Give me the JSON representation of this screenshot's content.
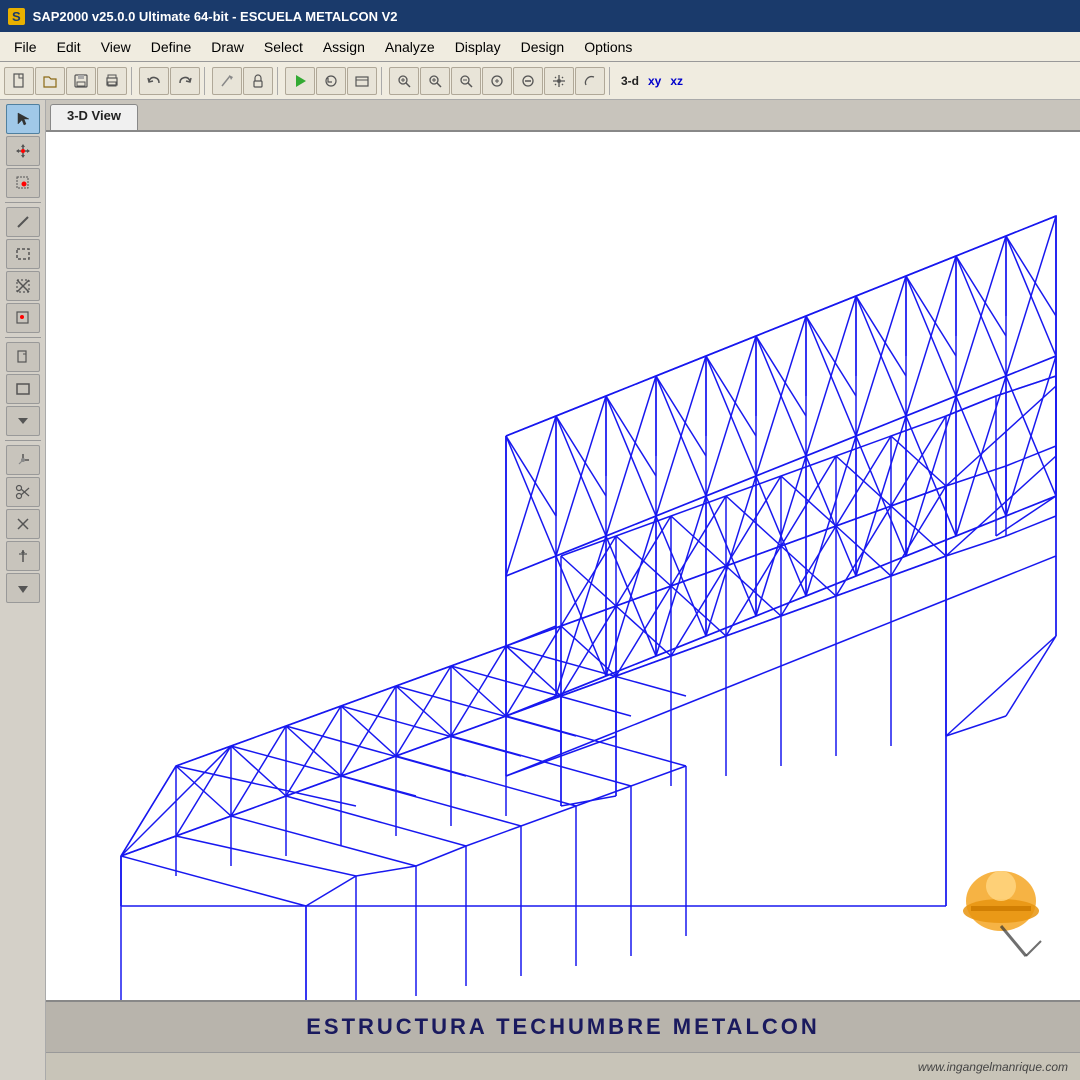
{
  "titlebar": {
    "logo": "S",
    "title": "SAP2000 v25.0.0 Ultimate 64-bit - ESCUELA METALCON V2"
  },
  "menubar": {
    "items": [
      "File",
      "Edit",
      "View",
      "Define",
      "Draw",
      "Select",
      "Assign",
      "Analyze",
      "Display",
      "Design",
      "Options"
    ]
  },
  "toolbar": {
    "view_modes": [
      "3-d",
      "xy",
      "xz"
    ],
    "buttons": [
      {
        "name": "new",
        "icon": "📄"
      },
      {
        "name": "open",
        "icon": "📁"
      },
      {
        "name": "save",
        "icon": "💾"
      },
      {
        "name": "print",
        "icon": "🖨"
      },
      {
        "name": "undo",
        "icon": "↩"
      },
      {
        "name": "redo",
        "icon": "↪"
      },
      {
        "name": "edit",
        "icon": "✏"
      },
      {
        "name": "lock",
        "icon": "🔒"
      },
      {
        "name": "run",
        "icon": "▶"
      },
      {
        "name": "refresh",
        "icon": "⟳"
      },
      {
        "name": "window",
        "icon": "⊡"
      },
      {
        "name": "zoom-in-rect",
        "icon": "🔍"
      },
      {
        "name": "zoom-in",
        "icon": "🔎+"
      },
      {
        "name": "zoom-out",
        "icon": "🔎-"
      },
      {
        "name": "zoom-fit",
        "icon": "⊕"
      },
      {
        "name": "zoom-minus",
        "icon": "⊖"
      },
      {
        "name": "pan",
        "icon": "✋"
      }
    ]
  },
  "left_toolbar": {
    "buttons": [
      {
        "name": "select-arrow",
        "icon": "↖",
        "active": true
      },
      {
        "name": "point-tool",
        "icon": "⊹"
      },
      {
        "name": "dot-box",
        "icon": "⊡"
      },
      {
        "name": "line-tool",
        "icon": "/"
      },
      {
        "name": "select-box",
        "icon": "⬚"
      },
      {
        "name": "x-select",
        "icon": "⊠"
      },
      {
        "name": "grid-point",
        "icon": "⊟"
      },
      {
        "name": "page-tool",
        "icon": "🗋"
      },
      {
        "name": "rect-tool",
        "icon": "☐"
      },
      {
        "name": "more-tools",
        "icon": "▼"
      },
      {
        "name": "crosshair",
        "icon": "⊕"
      },
      {
        "name": "scissors",
        "icon": "✂"
      },
      {
        "name": "cross-tool",
        "icon": "✕"
      },
      {
        "name": "move-tool",
        "icon": "⊕"
      },
      {
        "name": "arrow-down",
        "icon": "↙"
      }
    ]
  },
  "view": {
    "tab_label": "3-D View"
  },
  "bottom": {
    "title": "ESTRUCTURA TECHUMBRE METALCON"
  },
  "footer": {
    "website": "www.ingangelmanrique.com"
  },
  "structure": {
    "color": "#0000ee",
    "style": "wireframe 3D structural model"
  }
}
